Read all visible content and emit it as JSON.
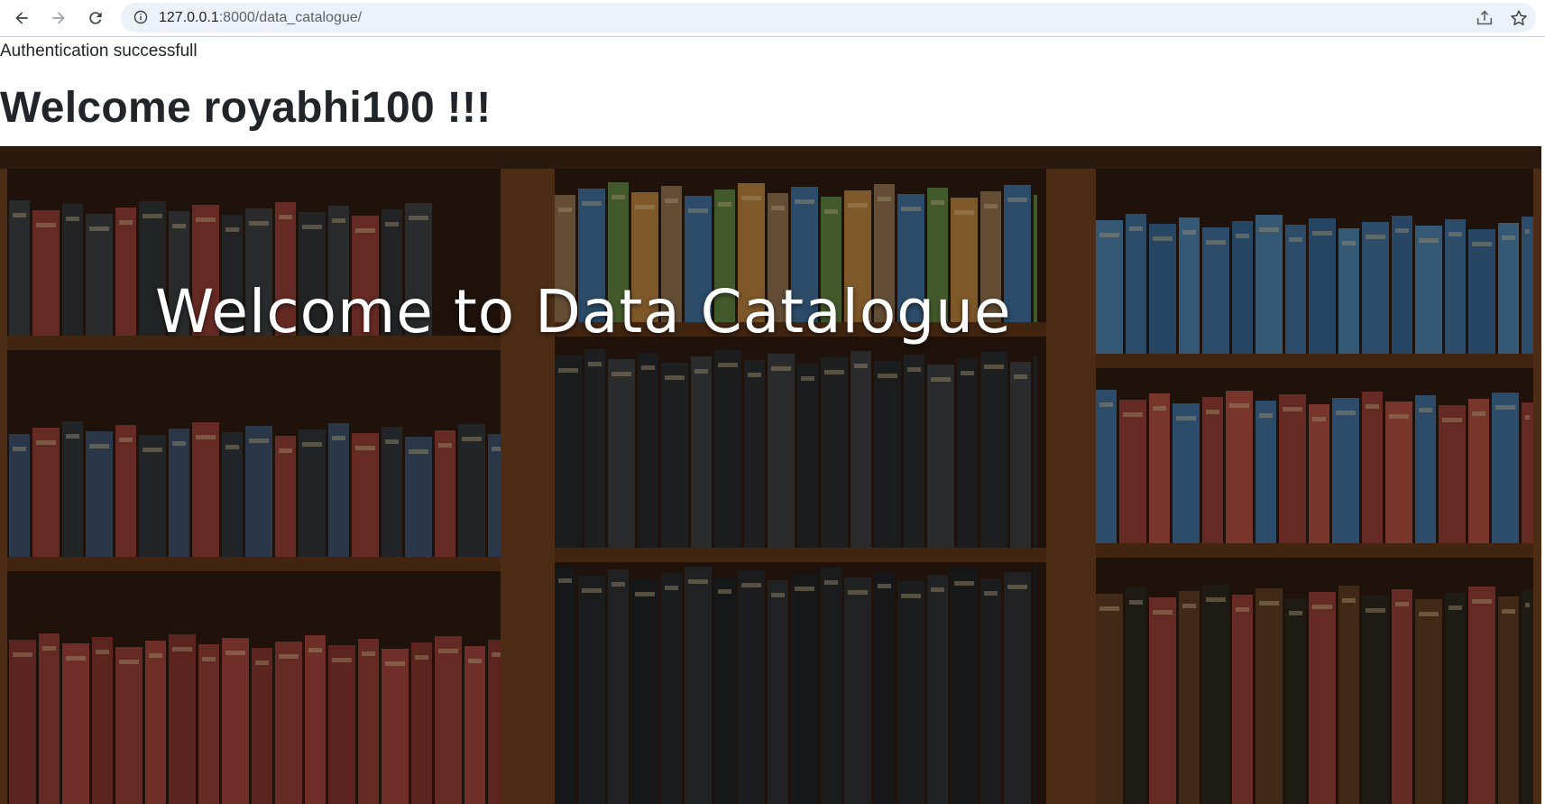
{
  "browser": {
    "url_host": "127.0.0.1",
    "url_path": ":8000/data_catalogue/",
    "icons": {
      "back": "arrow-left-icon",
      "forward": "arrow-right-icon",
      "reload": "reload-icon",
      "site_info": "info-icon",
      "share": "share-icon",
      "bookmark": "star-icon"
    }
  },
  "page": {
    "auth_message": "Authentication successfull",
    "welcome_heading": "Welcome royabhi100 !!!"
  },
  "hero": {
    "title": "Welcome to Data Catalogue",
    "image": "bookshelf-background"
  },
  "colors": {
    "omnibox_bg": "#edf2fa",
    "text": "#212529",
    "wood": "#5a3418",
    "book_red": "#8e3b32",
    "book_blue": "#3e6a92",
    "book_black": "#26282a"
  }
}
